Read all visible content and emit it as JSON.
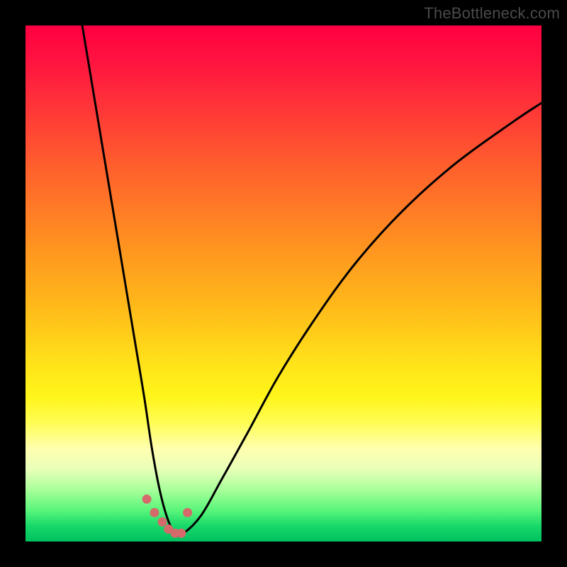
{
  "watermark": "TheBottleneck.com",
  "chart_data": {
    "type": "line",
    "title": "",
    "xlabel": "",
    "ylabel": "",
    "xlim": [
      0,
      100
    ],
    "ylim": [
      0,
      100
    ],
    "series": [
      {
        "name": "bottleneck-curve",
        "x": [
          11,
          13,
          15,
          17,
          19,
          21,
          23,
          24.5,
          26,
          27.5,
          29,
          30.5,
          34,
          38,
          43,
          49,
          56,
          64,
          73,
          83,
          94,
          100
        ],
        "values": [
          100,
          88,
          76,
          64,
          52,
          40,
          28,
          18,
          10,
          4.5,
          1.5,
          1.5,
          5,
          12,
          21,
          32,
          43,
          54,
          64,
          73,
          81,
          85
        ]
      },
      {
        "name": "highlight-dots",
        "x": [
          23.5,
          25,
          26.5,
          27.7,
          29,
          30.2,
          31.4
        ],
        "values": [
          8.2,
          5.6,
          3.8,
          2.4,
          1.6,
          1.6,
          5.6
        ]
      }
    ],
    "colors": {
      "curve": "#000000",
      "dots": "#d56a6a",
      "background_top": "#ff0040",
      "background_bottom": "#00c060"
    }
  }
}
